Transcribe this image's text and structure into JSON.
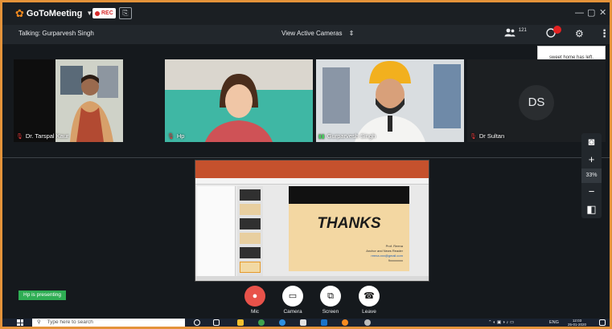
{
  "app": {
    "name": "GoToMeeting",
    "rec_label": "REC",
    "clipboard_icon": "clipboard-icon",
    "window_controls": [
      "—",
      "▢",
      "✕"
    ]
  },
  "talkbar": {
    "talking": "Talking: Gurparvesh Singh",
    "view_mode": "View Active Cameras",
    "attendee_count": "121"
  },
  "notification": {
    "text": "sweet home has left."
  },
  "participants": [
    {
      "name": "Dr. Tarspal Kaur",
      "muted": true
    },
    {
      "name": "Hp",
      "muted": true
    },
    {
      "name": "Gurparvesh Singh",
      "muted": false
    },
    {
      "name": "Dr Sultan",
      "muted": true,
      "initials": "DS"
    }
  ],
  "presentation": {
    "title": "THANKS",
    "presenter_lines": [
      "Prof. Reena",
      "Anchor and News Reader",
      "reena.xxx@gmail.com",
      "9xxxxxxxx"
    ]
  },
  "presenting_banner": "Hp is presenting",
  "controls": [
    {
      "label": "Mic",
      "icon": "microphone-icon"
    },
    {
      "label": "Camera",
      "icon": "camera-icon"
    },
    {
      "label": "Screen",
      "icon": "screen-share-icon"
    },
    {
      "label": "Leave",
      "icon": "phone-hangup-icon"
    }
  ],
  "zoom": {
    "percent": "33%"
  },
  "taskbar": {
    "search_placeholder": "Type here to search",
    "language": "ENG",
    "time": "12:03",
    "date": "25-01-2020"
  },
  "colors": {
    "accent": "#f68b1f",
    "record_red": "#d62b2b",
    "leave_red": "#e8524a",
    "presenting_green": "#2fae54",
    "window_border": "#e4933a"
  }
}
